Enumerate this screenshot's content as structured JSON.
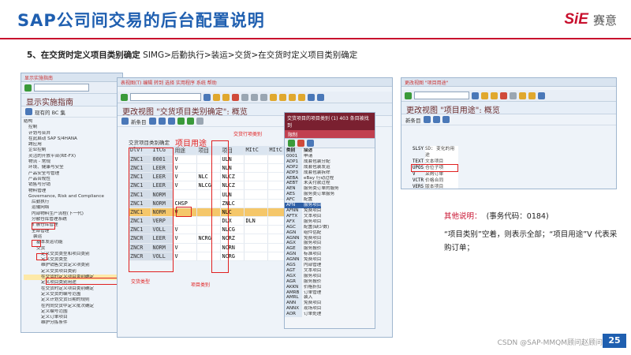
{
  "header": {
    "title": "SAP公司间交易的后台配置说明",
    "logo_mark": "SiE",
    "logo_text": "赛意"
  },
  "subtitle": {
    "step": "5、在交货时定义项目类别确定",
    "path": "SIMG>后勤执行>装运>交货>在交货时定义项目类别确定"
  },
  "w1": {
    "menu": "显示实施指南",
    "title": "显示实施指南",
    "apptb": "现有的 BC 集",
    "tree": [
      "结构",
      "控制",
      "计划与合并",
      "在此启动 SAP S/4HANA",
      "跨应用",
      "企业控制",
      "灵活的开放平台(RE-FX)",
      "物流 - 常规",
      "环境、健康与安全",
      "产品安全与管理",
      "产品合规性",
      "销售与分销",
      "物料管理",
      "Governance, Risk and Compliance",
      "后勤执行",
      "运输网络",
      "内部物料生产流程(下一代)",
      "分散仓库管理系统",
      "扩展仓库管理",
      "全部管理",
      "装运",
      "基本发运功能",
      "交货",
      "定义交货类型和项目类别",
      "定义交货类型",
      "维护销售交货定义项类别",
      "定义交货项目类别",
      "在交货时定义项目类别确定",
      "定义项目类别用途",
      "在交货时定义项目类别确定",
      "定义交货的编号范围",
      "定义计划交货日期的规则",
      "在内向交货中定义批次确定",
      "定义编号范围",
      "定义订单项目",
      "维护分拣条件"
    ]
  },
  "w2": {
    "menu": "表视图(T) 编辑 转到 选择 实用程序 系统 帮助",
    "title": "更改视图 \"交货项目类别确定\": 概览",
    "apptb": "新条目",
    "section": "交货项目类别确定",
    "cols": [
      "DlvT",
      "ItCG",
      "用途",
      "项目",
      "项目",
      "MItC",
      "MItC",
      "MItC"
    ],
    "rows": [
      [
        "ZNC1",
        "0001",
        "V",
        "",
        "ULN",
        "",
        "",
        ""
      ],
      [
        "ZNC1",
        "LEER",
        "V",
        "",
        "NLN",
        "",
        "",
        ""
      ],
      [
        "ZNC1",
        "LEER",
        "V",
        "NLC",
        "NLCZ",
        "",
        "",
        ""
      ],
      [
        "ZNC1",
        "LEER",
        "V",
        "NLCG",
        "NLCZ",
        "",
        "",
        ""
      ],
      [
        "ZNC1",
        "NORM",
        "",
        "",
        "ULN",
        "",
        "",
        ""
      ],
      [
        "ZNC1",
        "NORM",
        "CHSP",
        "",
        "ZNLC",
        "",
        "",
        ""
      ],
      [
        "ZNC1",
        "NORM",
        "V",
        "",
        "NLC",
        "",
        "",
        ""
      ],
      [
        "ZNC1",
        "VERP",
        "",
        "",
        "DLX",
        "DLN",
        "",
        ""
      ],
      [
        "ZNC1",
        "VOLL",
        "V",
        "",
        "NLCG",
        "",
        "",
        ""
      ],
      [
        "ZNCR",
        "LEER",
        "V",
        "NCRG",
        "NCRZ",
        "",
        "",
        ""
      ],
      [
        "ZNCR",
        "NORM",
        "V",
        "",
        "NCRN",
        "",
        "",
        ""
      ],
      [
        "ZNCR",
        "VOLL",
        "V",
        "",
        "NCRG",
        "",
        "",
        ""
      ]
    ],
    "ann_usage": "项目用途",
    "ann_dlv_item": "交货行项类别",
    "ann_dlv_type": "交货类型",
    "ann_item_cat": "项目类别"
  },
  "w3": {
    "head": "交货项目的项目类别 (1) 403 条目被找到",
    "menu": "限制",
    "cols": [
      "类别",
      "描述"
    ],
    "rows": [
      [
        "0001",
        "申请"
      ],
      [
        "ADP1",
        "成套包装分配"
      ],
      [
        "ADP2",
        "成套包装发运"
      ],
      [
        "ADP3",
        "成套包装拆除"
      ],
      [
        "AEBA",
        "eBay 行动过程"
      ],
      [
        "AEBT",
        "未关付款过程"
      ],
      [
        "AEN",
        "服务类订单的服务"
      ],
      [
        "AES",
        "服务类订单服务"
      ],
      [
        "AFC",
        "配置"
      ],
      [
        "AFN",
        "服务项目"
      ],
      [
        "AFNN",
        "免费项目"
      ],
      [
        "AFTX",
        "文本项目"
      ],
      [
        "AFX",
        "服务项目"
      ],
      [
        "AGC",
        "配置(缺少数)"
      ],
      [
        "AGN",
        "组件估配"
      ],
      [
        "AGNN",
        "免费项目"
      ],
      [
        "AGX",
        "服务项目"
      ],
      [
        "AGE",
        "服务报价"
      ],
      [
        "AGN",
        "标准项目"
      ],
      [
        "AGNN",
        "免费项目"
      ],
      [
        "AGS",
        "内部管理"
      ],
      [
        "AGT",
        "文本项目"
      ],
      [
        "AGX",
        "服务项目"
      ],
      [
        "AGR",
        "服务报价"
      ],
      [
        "AKKN",
        "价格折扣"
      ],
      [
        "AMRB",
        "订单管理"
      ],
      [
        "AMRL",
        "装入"
      ],
      [
        "ANN",
        "免费项目"
      ],
      [
        "ANNX",
        "现场项目"
      ],
      [
        "AOR",
        "订单处理"
      ]
    ],
    "selected": 9
  },
  "w4": {
    "menu": "更改视图 \"项目用途\"",
    "title": "更改视图 \"项目用途\": 概览",
    "apptb": "新条目",
    "rows": [
      [
        "SLSY",
        "SD: 变化的用途"
      ],
      [
        "TEXT",
        "文本项目"
      ],
      [
        "UPOS",
        "仓位子项"
      ],
      [
        "V",
        "采购订单"
      ],
      [
        "VCTR",
        "价格合同"
      ],
      [
        "VERS",
        "版本项目"
      ]
    ]
  },
  "note": {
    "title": "其他说明：",
    "code": "(事务代码：0184)",
    "body": "“项目类别”空着，则表示全部；“项目用途”V 代表采购订单；"
  },
  "footer": {
    "credit": "CSDN @SAP-MMQM顾问赵顾问",
    "page": "25"
  }
}
